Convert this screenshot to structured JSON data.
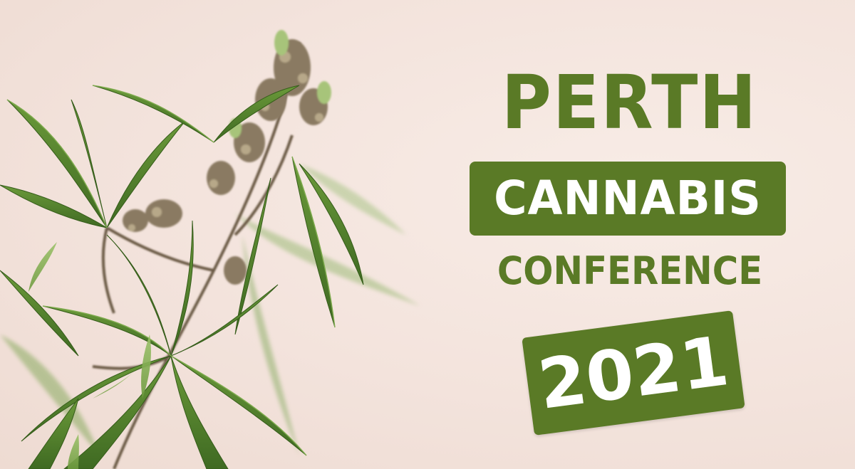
{
  "title": {
    "line1": "PERTH",
    "line2": "CANNABIS",
    "line3": "CONFERENCE",
    "year": "2021"
  },
  "colors": {
    "brand_green": "#5a7a26",
    "background": "#f4e6df",
    "badge_text": "#ffffff"
  },
  "image": {
    "subject": "cannabis-plant-illustration"
  }
}
